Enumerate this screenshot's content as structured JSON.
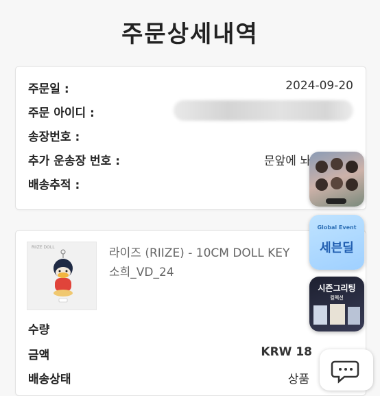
{
  "page": {
    "title": "주문상세내역"
  },
  "order_info": {
    "order_date_label": "주문일 :",
    "order_date_value": "2024-09-20",
    "order_id_label": "주문 아이디 :",
    "invoice_label": "송장번호 :",
    "extra_invoice_label": "추가 운송장 번호 :",
    "extra_invoice_value": "문앞에 놔",
    "tracking_label": "배송추적 :"
  },
  "product": {
    "name": "라이즈 (RIIZE) - 10CM DOLL KEY",
    "option": "소희_VD_24",
    "thumb_label": "RIIZE DOLL",
    "quantity_label": "수량",
    "amount_label": "금액",
    "amount_value": "KRW 18",
    "status_label": "배송상태",
    "status_value": "상품"
  },
  "ads": [
    {
      "name": "idol-group-promo",
      "text": ""
    },
    {
      "name": "seven-deal-promo",
      "top_text": "Global Event",
      "text": "세븐딜"
    },
    {
      "name": "season-greeting-promo",
      "text": "시즌그리팅",
      "sub_text": "컬렉션"
    }
  ],
  "colors": {
    "accent": "#b3202a",
    "background": "#f7f7f7"
  }
}
